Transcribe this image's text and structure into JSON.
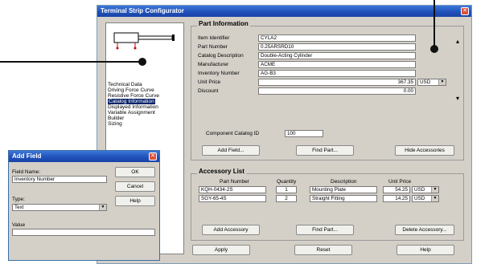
{
  "window": {
    "title": "Terminal Strip Configurator"
  },
  "nav": [
    "Technical Data",
    "Driving Force Curve",
    "Resistive Force Curve",
    "Catalog Information",
    "Displayed Information",
    "Variable Assignment",
    "Builder",
    "Sizing"
  ],
  "nav_selected_index": 3,
  "part_info": {
    "title": "Part Information",
    "fields": [
      {
        "label": "Item Identifier",
        "value": "CYLA2"
      },
      {
        "label": "Part Number",
        "value": "0.25ARSRD10"
      },
      {
        "label": "Catalog Description",
        "value": "Double-Acting Cylinder"
      },
      {
        "label": "Manufacturer",
        "value": "ACME"
      },
      {
        "label": "Inventory Number",
        "value": "AG-B3"
      },
      {
        "label": "Unit Price",
        "value": "367.35",
        "currency": "USD"
      },
      {
        "label": "Discount",
        "value": "0.00"
      }
    ],
    "catalog_id_label": "Component Catalog ID",
    "catalog_id_value": "100",
    "buttons": {
      "add_field": "Add Field...",
      "find_part": "Find Part...",
      "hide_accessories": "Hide Accessories"
    }
  },
  "accessory": {
    "title": "Accessory List",
    "headers": [
      "Part Number",
      "Quantity",
      "Description",
      "Unit Price"
    ],
    "rows": [
      {
        "part": "KQH-0434-2S",
        "qty": "1",
        "desc": "Mounting Plate",
        "price": "54.25",
        "currency": "USD"
      },
      {
        "part": "SGY-65-4S",
        "qty": "2",
        "desc": "Straight Fitting",
        "price": "14.25",
        "currency": "USD"
      }
    ],
    "buttons": {
      "add": "Add Accessory",
      "find": "Find Part...",
      "delete": "Delete Accessory..."
    }
  },
  "bottom_buttons": {
    "apply": "Apply",
    "reset": "Reset",
    "help": "Help"
  },
  "add_field_dialog": {
    "title": "Add Field",
    "field_name_label": "Field Name:",
    "field_name_value": "Inventory Number",
    "type_label": "Type:",
    "type_value": "Text",
    "value_label": "Value",
    "value_value": "",
    "buttons": {
      "ok": "OK",
      "cancel": "Cancel",
      "help": "Help"
    }
  },
  "icons": {
    "close": "close-icon",
    "dropdown": "chevron-down-icon",
    "scroll_up": "arrow-up-icon",
    "scroll_down": "arrow-down-icon"
  },
  "colors": {
    "titlebar": "#1f4fb8",
    "selection": "#0a246a",
    "dialog_bg": "#d4d0c8",
    "close_button": "#d9513b"
  }
}
